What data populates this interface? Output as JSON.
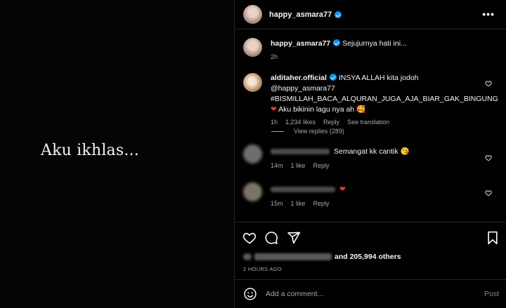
{
  "media": {
    "overlay_text": "Aku ikhlas..."
  },
  "header": {
    "username": "happy_asmara77",
    "more_label": "•••"
  },
  "caption": {
    "username": "happy_asmara77",
    "text": "Sejujurnya hati ini...",
    "time": "2h"
  },
  "comments": [
    {
      "username": "alditaher.official",
      "text": "INSYA ALLAH kita jodoh @happy_asmara77 #BISMILLAH_BACA_ALQURAN_JUGA_AJA_BIAR_GAK_BINGUNG",
      "text2": "Aku bikinin lagu nya ah",
      "emoji": "🥰",
      "time": "1h",
      "likes": "1,234 likes",
      "reply": "Reply",
      "translate": "See translation",
      "view_replies": "View replies (289)"
    },
    {
      "text": "Semangat kk cantik",
      "emoji": "😘",
      "time": "14m",
      "likes": "1 like",
      "reply": "Reply"
    },
    {
      "text": "",
      "time": "15m",
      "likes": "1 like",
      "reply": "Reply"
    }
  ],
  "likes": {
    "others": "and 205,994 others"
  },
  "timestamp": "2 HOURS AGO",
  "comment_box": {
    "placeholder": "Add a comment...",
    "post_label": "Post"
  },
  "colors": {
    "verified": "#0095f6",
    "heart": "#ff3040",
    "muted": "#a8a8a8",
    "background": "#000000"
  },
  "icons": [
    "more-options-icon",
    "heart-icon",
    "comment-icon",
    "share-icon",
    "bookmark-icon",
    "emoji-icon",
    "verified-badge-icon"
  ]
}
